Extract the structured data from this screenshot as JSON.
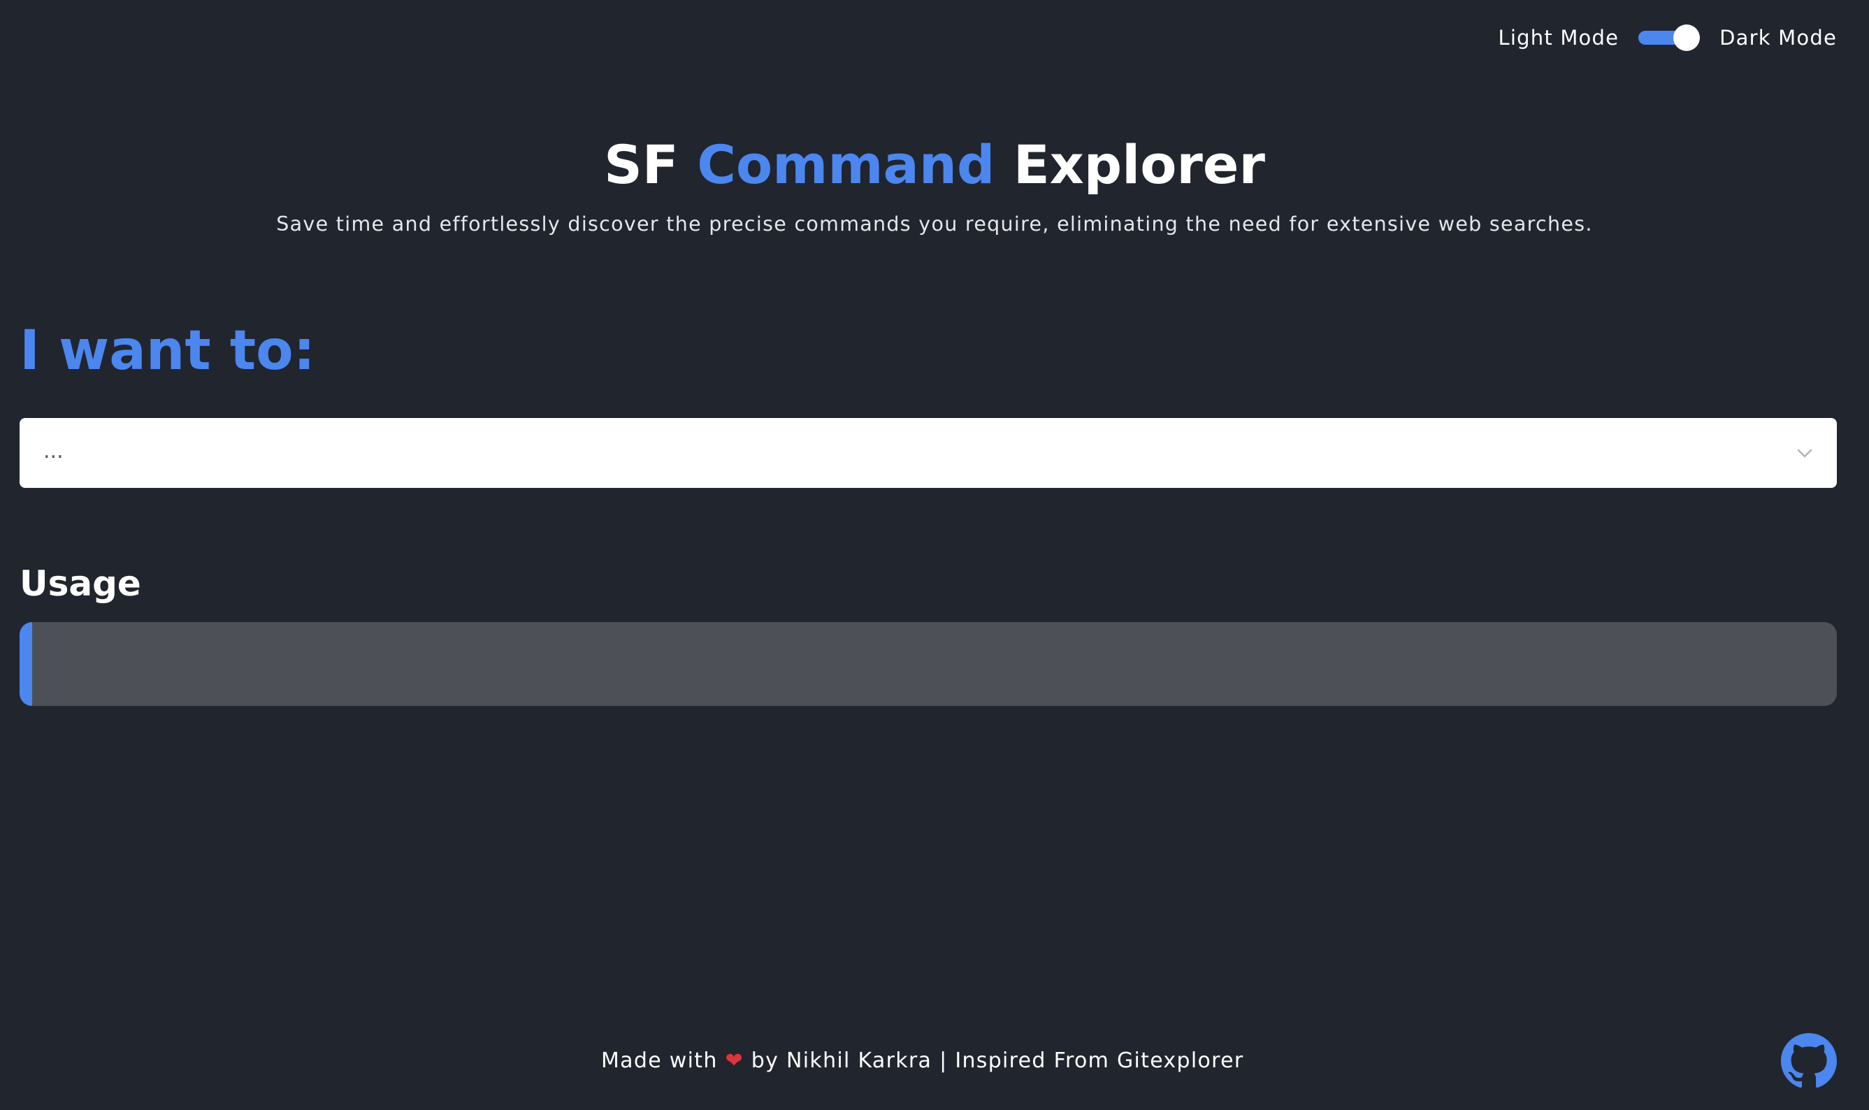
{
  "mode_toggle": {
    "light_label": "Light Mode",
    "dark_label": "Dark Mode",
    "state": "dark"
  },
  "header": {
    "title_part1": "SF",
    "title_accent": "Command",
    "title_part2": "Explorer",
    "subtitle": "Save time and effortlessly discover the precise commands you require, eliminating the need for extensive web searches."
  },
  "main": {
    "want_heading": "I want to:",
    "select_value": "...",
    "usage_heading": "Usage"
  },
  "footer": {
    "made_with": "Made with",
    "heart": "❤",
    "by_text": "by Nikhil Karkra | Inspired From Gitexplorer"
  },
  "icons": {
    "select": "chevron-down-icon",
    "repo": "github-icon",
    "heart": "heart-icon"
  },
  "colors": {
    "background": "#21252e",
    "accent": "#4c86ef",
    "usage_box": "#4d5056",
    "heart": "#e0343c"
  }
}
